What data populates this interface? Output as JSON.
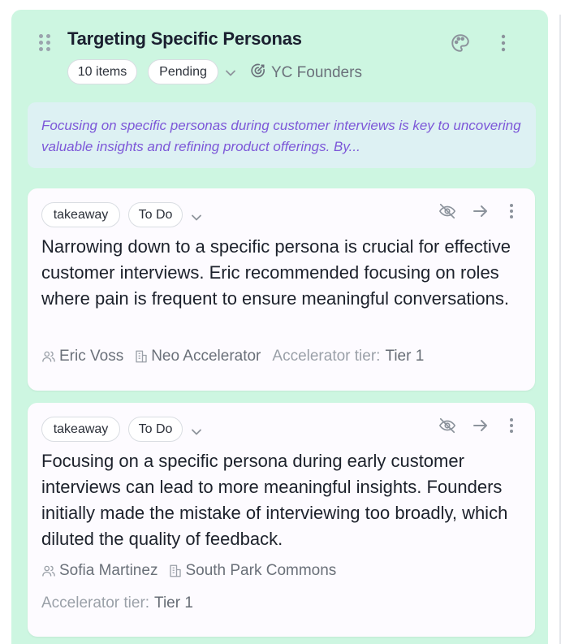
{
  "column": {
    "title": "Targeting Specific Personas",
    "item_count": "10 items",
    "status": "Pending",
    "team": "YC Founders",
    "icons": [
      "drag-handle-icon",
      "palette-icon",
      "more-vertical-icon",
      "chevron-down-icon",
      "target-icon"
    ],
    "summary": "Focusing on specific personas during customer interviews is key to uncovering valuable insights and refining product offerings. By..."
  },
  "cards": [
    {
      "tag": "takeaway",
      "status": "To Do",
      "text": "Narrowing down to a specific persona is crucial for effective customer interviews. Eric recommended focusing on roles where pain is frequent to ensure meaningful conversations.",
      "person": "Eric Voss",
      "org": "Neo Accelerator",
      "tier_label": "Accelerator tier:",
      "tier_value": "Tier 1"
    },
    {
      "tag": "takeaway",
      "status": "To Do",
      "text": "Focusing on a specific persona during early customer interviews can lead to more meaningful insights. Founders initially made the mistake of interviewing too broadly, which diluted the quality of feedback.",
      "person": "Sofia Martinez",
      "org": "South Park Commons",
      "tier_label": "Accelerator tier:",
      "tier_value": "Tier 1"
    }
  ],
  "card_icons": [
    "eye-off-icon",
    "arrow-right-icon",
    "more-vertical-icon",
    "users-icon",
    "building-icon"
  ],
  "colors": {
    "column_bg": "#cdf6e1",
    "summary_bg": "#ddf1f3",
    "summary_text": "#7c57d8",
    "card_bg": "#fdfbff"
  }
}
